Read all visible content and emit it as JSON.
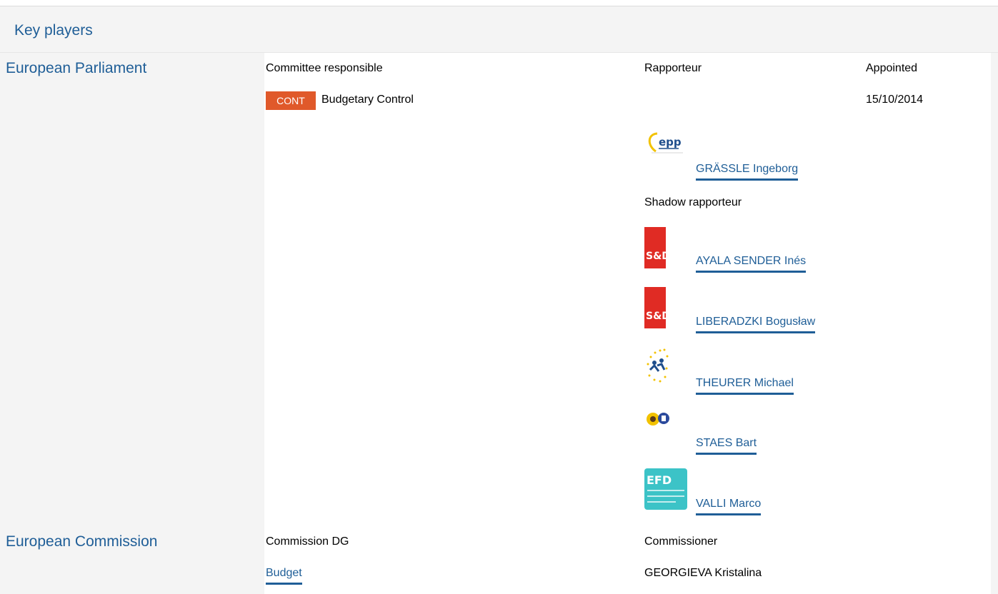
{
  "header": {
    "title": "Key players"
  },
  "parliament": {
    "label": "European Parliament",
    "col_committee": "Committee responsible",
    "col_rapporteur": "Rapporteur",
    "col_appointed": "Appointed",
    "committee_badge": "CONT",
    "committee_name": "Budgetary Control",
    "appointed_date": "15/10/2014",
    "rapporteur": {
      "name": "GRÄSSLE Ingeborg",
      "logo_text": "epp",
      "group_icon": "epp-logo-icon"
    },
    "shadow_label": "Shadow rapporteur",
    "shadows": [
      {
        "name": "AYALA SENDER Inés",
        "logo_text": "S&D",
        "group_icon": "sd-logo-icon"
      },
      {
        "name": "LIBERADZKI Bogusław",
        "logo_text": "S&D",
        "group_icon": "sd-logo-icon"
      },
      {
        "name": "THEURER Michael",
        "group_icon": "alde-logo-icon"
      },
      {
        "name": "STAES Bart",
        "group_icon": "greens-efa-logo-icon"
      },
      {
        "name": "VALLI Marco",
        "logo_text": "EFD",
        "group_icon": "efd-logo-icon"
      }
    ]
  },
  "commission": {
    "label": "European Commission",
    "col_dg": "Commission DG",
    "col_commissioner": "Commissioner",
    "dg": "Budget",
    "commissioner": "GEORGIEVA Kristalina"
  },
  "colors": {
    "link": "#1f5e97",
    "badge": "#e0592a",
    "panel": "#f4f4f4",
    "sd_red": "#e02b24",
    "efd_teal": "#3cc3c7"
  }
}
